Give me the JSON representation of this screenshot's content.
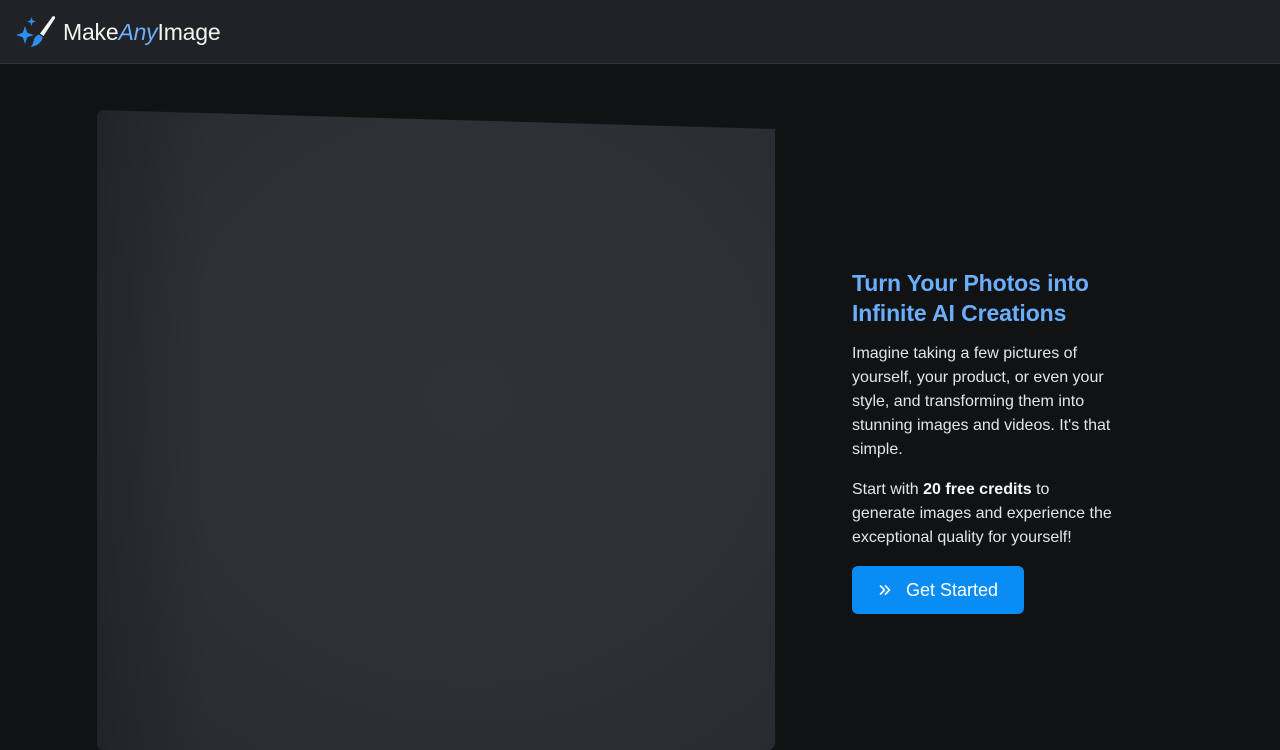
{
  "header": {
    "logo": {
      "icon": "sparkles-brush-icon",
      "text_part1": "Make",
      "text_part2": "Any",
      "text_part3": "Image"
    }
  },
  "hero": {
    "headline": "Turn Your Photos into Infinite AI Creations",
    "paragraph1": "Imagine taking a few pictures of yourself, your product, or even your style, and transforming them into stunning images and videos. It's that simple.",
    "paragraph2_prefix": "Start with ",
    "paragraph2_bold": "20 free credits",
    "paragraph2_suffix": " to generate images and experience the exceptional quality for yourself!",
    "cta_label": "Get Started",
    "cta_icon": "double-chevron-right-icon"
  },
  "colors": {
    "accent": "#6aaefc",
    "button": "#0a8cf5",
    "background": "#111214",
    "header_bg": "#212226"
  }
}
